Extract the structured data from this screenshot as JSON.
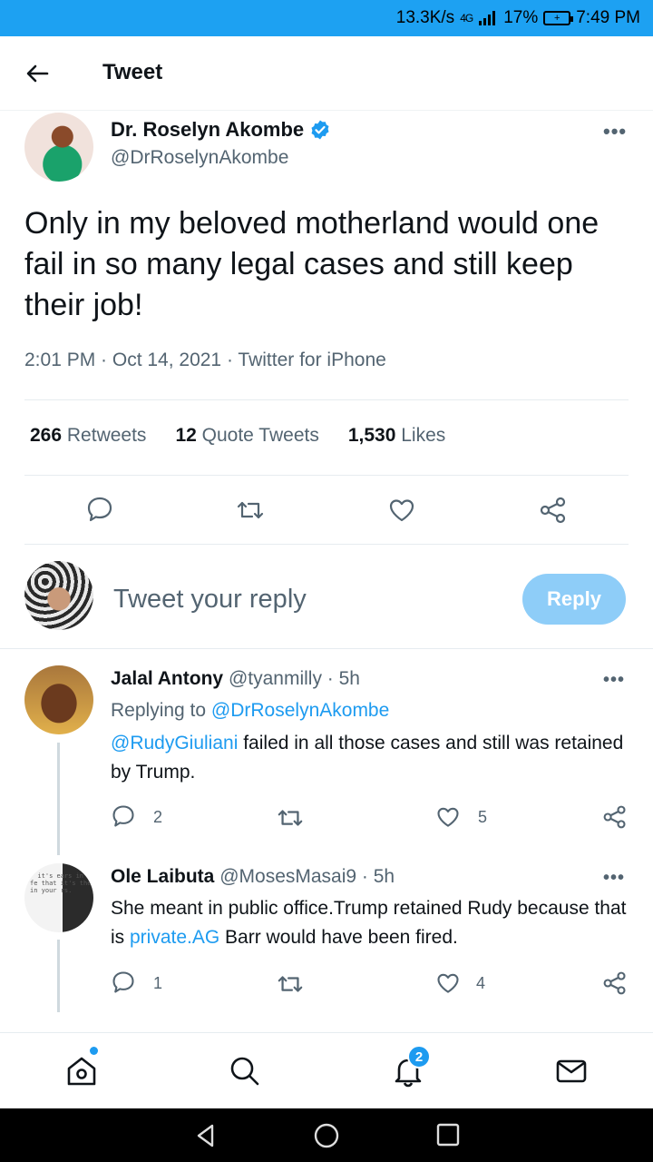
{
  "status_bar": {
    "speed": "13.3K/s",
    "network": "4G",
    "battery": "17%",
    "time": "7:49 PM"
  },
  "header": {
    "title": "Tweet"
  },
  "tweet": {
    "author_name": "Dr. Roselyn Akombe",
    "author_handle": "@DrRoselynAkombe",
    "text": "Only in my beloved motherland would one fail in so many legal cases and still keep their job!",
    "meta": "2:01 PM · Oct 14, 2021 · Twitter for iPhone",
    "stats": {
      "retweets_count": "266",
      "retweets_label": "Retweets",
      "quotes_count": "12",
      "quotes_label": "Quote Tweets",
      "likes_count": "1,530",
      "likes_label": "Likes"
    }
  },
  "composer": {
    "placeholder": "Tweet your reply",
    "button_label": "Reply"
  },
  "replies": [
    {
      "name": "Jalal Antony",
      "handle": "@tyanmilly",
      "age": "· 5h",
      "replying_prefix": "Replying to",
      "replying_to": "@DrRoselynAkombe",
      "mention": "@RudyGiuliani",
      "text_rest": " failed in all those cases and still was retained by Trump.",
      "reply_count": "2",
      "like_count": "5"
    },
    {
      "name": "Ole Laibuta",
      "handle": "@MosesMasai9",
      "age": "· 5h",
      "text_before": "She meant in public office.Trump retained Rudy because that is ",
      "link": "private.AG",
      "text_after": " Barr would have been fired.",
      "reply_count": "1",
      "like_count": "4",
      "avatar_text": "“ it's ears in fe that it's the in your rs."
    }
  ],
  "bottom_nav": {
    "notifications_badge": "2"
  },
  "colors": {
    "accent": "#1d9bf0",
    "status_bar": "#1da1f2",
    "reply_button": "#8ecdf8",
    "secondary_text": "#536471"
  },
  "icons": [
    "back-arrow-icon",
    "verified-icon",
    "more-icon",
    "reply-icon",
    "retweet-icon",
    "like-icon",
    "share-icon",
    "home-icon",
    "search-icon",
    "bell-icon",
    "mail-icon"
  ]
}
